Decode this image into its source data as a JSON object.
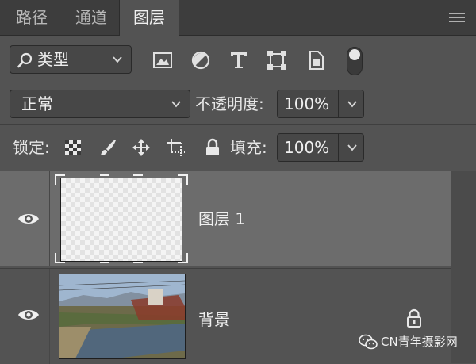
{
  "tabs": [
    {
      "label": "路径",
      "active": false
    },
    {
      "label": "通道",
      "active": false
    },
    {
      "label": "图层",
      "active": true
    }
  ],
  "filter": {
    "selected": "类型",
    "icons": [
      "image-filter-icon",
      "adjustment-filter-icon",
      "type-filter-icon",
      "shape-filter-icon",
      "smart-object-filter-icon"
    ],
    "toggle_icon": "filter-toggle-icon"
  },
  "blend": {
    "mode": "正常",
    "opacity_label": "不透明度:",
    "opacity_value": "100%"
  },
  "lock": {
    "label": "锁定:",
    "icons": [
      "lock-transparent-pixels-icon",
      "lock-image-pixels-icon",
      "lock-position-icon",
      "lock-artboard-icon",
      "lock-all-icon"
    ],
    "fill_label": "填充:",
    "fill_value": "100%"
  },
  "layers": [
    {
      "name": "图层 1",
      "selected": true,
      "visible": true,
      "thumbnail": "transparent"
    },
    {
      "name": "背景",
      "selected": false,
      "visible": true,
      "thumbnail": "photo",
      "locked": true
    }
  ],
  "watermark": {
    "text": "CN青年摄影网"
  },
  "colors": {
    "panel_bg": "#535353",
    "tab_bar_bg": "#3d3d3d",
    "selected_layer_bg": "#6c6c6c",
    "field_bg": "#474747"
  }
}
